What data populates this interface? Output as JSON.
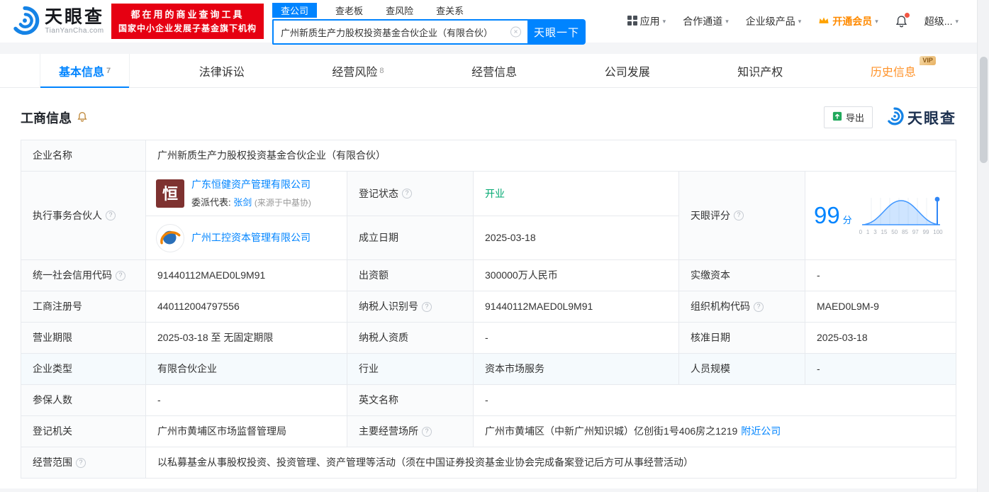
{
  "brand": {
    "name": "天眼查",
    "domain": "TianYanCha.com",
    "promo_line1": "都在用的商业查询工具",
    "promo_line2": "国家中小企业发展子基金旗下机构"
  },
  "search": {
    "tabs": [
      "查公司",
      "查老板",
      "查风险",
      "查关系"
    ],
    "value": "广州新质生产力股权投资基金合伙企业（有限合伙）",
    "button": "天眼一下"
  },
  "topnav": {
    "apps": "应用",
    "partner_channel": "合作通道",
    "enterprise": "企业级产品",
    "vip": "开通会员",
    "account": "超级..."
  },
  "tabs": {
    "basic": {
      "label": "基本信息",
      "count": "7"
    },
    "legal": {
      "label": "法律诉讼"
    },
    "risk": {
      "label": "经营风险",
      "count": "8"
    },
    "operation": {
      "label": "经营信息"
    },
    "development": {
      "label": "公司发展"
    },
    "ip": {
      "label": "知识产权"
    },
    "history": {
      "label": "历史信息",
      "badge": "VIP"
    }
  },
  "section": {
    "title": "工商信息",
    "export": "导出",
    "watermark": "天眼查"
  },
  "table": {
    "company_name": {
      "label": "企业名称",
      "value": "广州新质生产力股权投资基金合伙企业（有限合伙）"
    },
    "partners": {
      "label": "执行事务合伙人",
      "items": [
        {
          "name": "广东恒健资产管理有限公司",
          "rep_label": "委派代表:",
          "rep_name": "张剑",
          "rep_note": "(来源于中基协)",
          "logo_text": "恒"
        },
        {
          "name": "广州工控资本管理有限公司"
        }
      ]
    },
    "reg_status": {
      "label": "登记状态",
      "value": "开业"
    },
    "establish_date": {
      "label": "成立日期",
      "value": "2025-03-18"
    },
    "score": {
      "label": "天眼评分",
      "value": "99",
      "unit": "分",
      "axis": [
        "0",
        "1",
        "3",
        "15",
        "50",
        "85",
        "97",
        "99",
        "100"
      ]
    },
    "credit_code": {
      "label": "统一社会信用代码",
      "value": "91440112MAED0L9M91"
    },
    "contribution": {
      "label": "出资额",
      "value": "300000万人民币"
    },
    "paid_capital": {
      "label": "实缴资本",
      "value": "-"
    },
    "reg_number": {
      "label": "工商注册号",
      "value": "440112004797556"
    },
    "taxpayer_id": {
      "label": "纳税人识别号",
      "value": "91440112MAED0L9M91"
    },
    "org_code": {
      "label": "组织机构代码",
      "value": "MAED0L9M-9"
    },
    "term": {
      "label": "营业期限",
      "value": "2025-03-18 至 无固定期限"
    },
    "taxpayer_quality": {
      "label": "纳税人资质",
      "value": "-"
    },
    "approval_date": {
      "label": "核准日期",
      "value": "2025-03-18"
    },
    "company_type": {
      "label": "企业类型",
      "value": "有限合伙企业"
    },
    "industry": {
      "label": "行业",
      "value": "资本市场服务"
    },
    "staff_size": {
      "label": "人员规模",
      "value": "-"
    },
    "insured": {
      "label": "参保人数",
      "value": "-"
    },
    "english_name": {
      "label": "英文名称",
      "value": "-"
    },
    "registry": {
      "label": "登记机关",
      "value": "广州市黄埔区市场监督管理局"
    },
    "premises": {
      "label": "主要经营场所",
      "value": "广州市黄埔区（中新广州知识城）亿创街1号406房之1219",
      "link": "附近公司"
    },
    "scope": {
      "label": "经营范围",
      "value": "以私募基金从事股权投资、投资管理、资产管理等活动（须在中国证券投资基金业协会完成备案登记后方可从事经营活动）"
    }
  },
  "icons": {
    "caret": "▾",
    "help": "?",
    "clear": "✕"
  },
  "colors": {
    "accent": "#0084ff",
    "brand_red": "#e60012",
    "status_green": "#00a870",
    "vip_orange": "#ff9228"
  }
}
